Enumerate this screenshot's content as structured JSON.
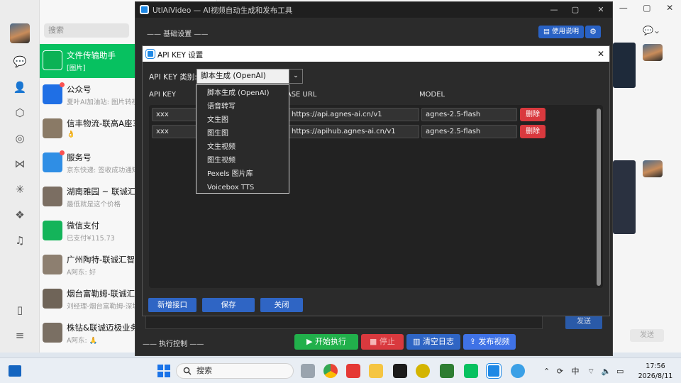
{
  "wechat": {
    "search_placeholder": "搜索",
    "chats": [
      {
        "name": "文件传输助手",
        "msg": "[图片]"
      },
      {
        "name": "公众号",
        "msg": "夏叶AI加油站: 图片转视频..."
      },
      {
        "name": "信丰物流-联高A座3楼",
        "msg": "👌"
      },
      {
        "name": "服务号",
        "msg": "京东快递: 签收成功通知"
      },
      {
        "name": "湖南雅园 ~ 联诚汇智",
        "msg": "最低就是这个价格"
      },
      {
        "name": "微信支付",
        "msg": "已支付¥115.73"
      },
      {
        "name": "广州陶特-联诚汇智",
        "msg": "A阿东: 好"
      },
      {
        "name": "烟台富勒姆-联诚汇智",
        "msg": "刘经理-烟台富勒姆-深圳..."
      },
      {
        "name": "株钻&联诚迈极业务群",
        "msg": "A阿东: 🙏"
      }
    ],
    "send_label": "发送"
  },
  "app": {
    "title": "UtlAiVideo — AI视频自动生成和发布工具",
    "section_basic": "—— 基础设置 ——",
    "usage_label": "使用说明",
    "section_exec": "—— 执行控制 ——",
    "start_label": "▶ 开始执行",
    "stop_label": "■ 停止",
    "clear_label": "清空日志",
    "publish_label": "发布视频",
    "send_label": "发送"
  },
  "dialog": {
    "title": "API KEY 设置",
    "type_label": "API KEY 类别:",
    "type_value": "脚本生成 (OpenAI)",
    "columns": {
      "api_key": "API KEY",
      "base_url": "BASE URL",
      "model": "MODEL"
    },
    "rows": [
      {
        "api_key": "xxx",
        "base_url": "https://api.agnes-ai.cn/v1",
        "model": "agnes-2.5-flash",
        "delete": "删除"
      },
      {
        "api_key": "xxx",
        "base_url": "https://apihub.agnes-ai.cn/v1",
        "model": "agnes-2.5-flash",
        "delete": "删除"
      }
    ],
    "add_label": "新增接口",
    "save_label": "保存",
    "close_label": "关闭",
    "dropdown_options": [
      "脚本生成 (OpenAI)",
      "语音转写",
      "文生图",
      "图生图",
      "文生视频",
      "图生视频",
      "Pexels 图片库",
      "Voicebox TTS"
    ]
  },
  "taskbar": {
    "search_label": "搜索",
    "tray_lang": "中",
    "time": "17:56",
    "date": "2026/8/11"
  },
  "colors": {
    "accent_blue": "#2f65c4",
    "danger_red": "#d9393e",
    "start_green": "#21b04b",
    "wechat_green": "#07c160"
  }
}
